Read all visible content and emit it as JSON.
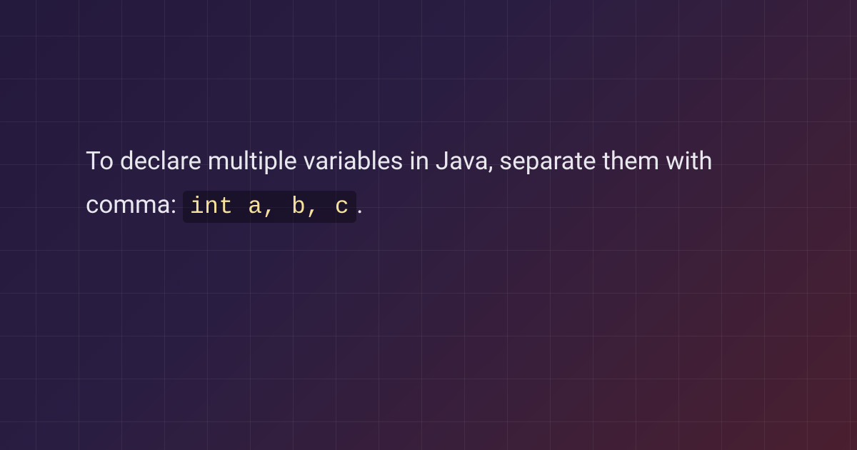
{
  "content": {
    "text_before": "To declare multiple variables in Java, separate them with comma: ",
    "code": "int a, b, c",
    "text_after": "."
  }
}
